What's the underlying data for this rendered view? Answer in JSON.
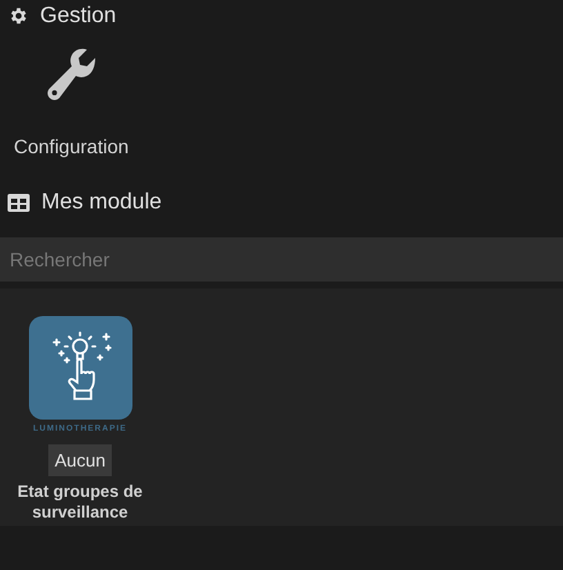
{
  "gestion": {
    "title": "Gestion",
    "items": [
      {
        "label": "Configuration"
      }
    ]
  },
  "modules_section": {
    "title": "Mes module"
  },
  "search": {
    "placeholder": "Rechercher"
  },
  "modules": [
    {
      "logo_text": "LUMINOTHERAPIE",
      "badge": "Aucun",
      "name": "Etat groupes de surveillance"
    }
  ]
}
